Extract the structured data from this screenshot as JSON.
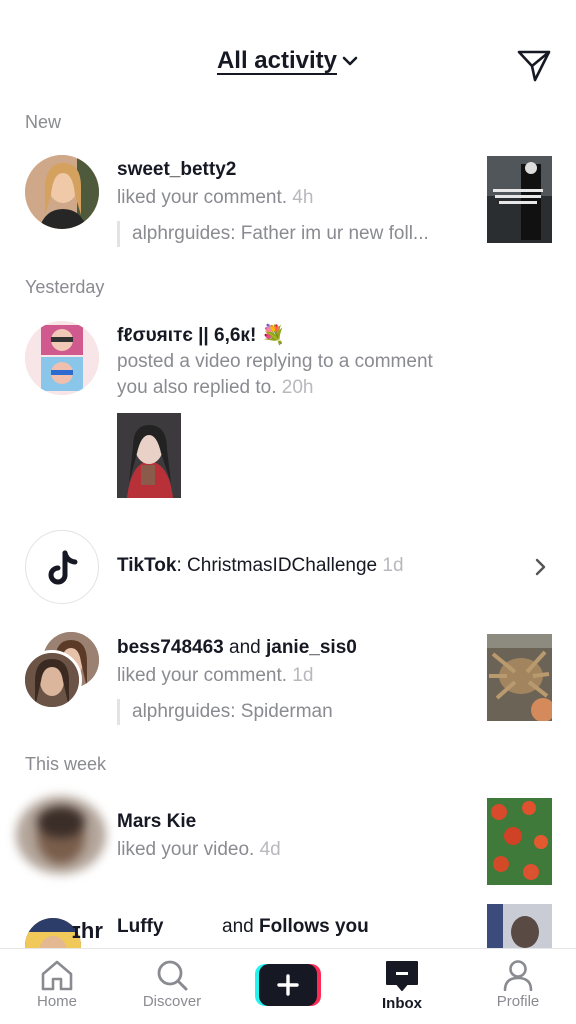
{
  "header": {
    "title": "All activity",
    "title_icon": "chevron-down-icon",
    "send_icon": "paper-plane-icon"
  },
  "sections": {
    "new": "New",
    "yesterday": "Yesterday",
    "this_week": "This week"
  },
  "notifications": [
    {
      "user": "sweet_betty2",
      "action": "liked your comment.",
      "time": "4h",
      "quote": "alphrguides: Father im ur new foll...",
      "thumb_text": "Me and my best friend"
    },
    {
      "user": "fℓσυяιтє || 6,6к! 💐",
      "action_line1": "posted a video replying to a comment",
      "action_line2": "you also replied to.",
      "time": "20h"
    },
    {
      "brand": "TikTok",
      "text": ": ChristmasIDChallenge",
      "time": "1d"
    },
    {
      "user1": "bess748463",
      "joiner": " and ",
      "user2": "janie_sis0",
      "action": "liked your comment.",
      "time": "1d",
      "quote": "alphrguides: Spiderman"
    },
    {
      "user": "Mars Kie",
      "action": "liked your video.",
      "time": "4d"
    },
    {
      "user": "Luffy",
      "joiner": "and ",
      "follows": "Follows you"
    }
  ],
  "tabbar": {
    "home": "Home",
    "discover": "Discover",
    "inbox": "Inbox",
    "profile": "Profile"
  },
  "colors": {
    "primary_text": "#161823",
    "secondary_text": "#8a8b91",
    "accent_cyan": "#25F4EE",
    "accent_red": "#FE2C55"
  }
}
